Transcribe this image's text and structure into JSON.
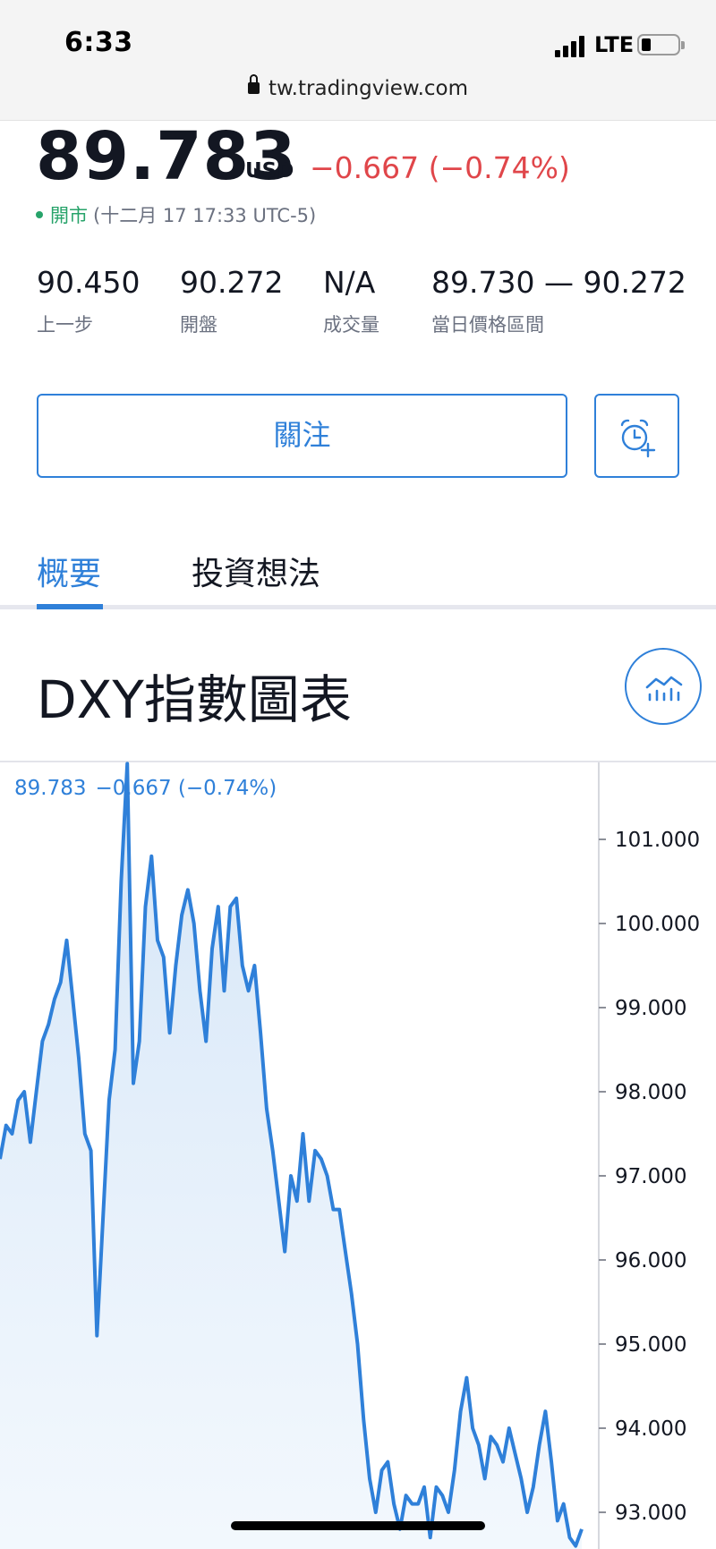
{
  "status_bar": {
    "time": "6:33",
    "network": "LTE",
    "url": "tw.tradingview.com"
  },
  "quote": {
    "price": "89.783",
    "currency": "USD",
    "change": "−0.667 (−0.74%)",
    "change_color": "#e0464a",
    "market_status": "開市",
    "market_status_color": "#27a36a",
    "timestamp": "(十二月 17 17:33 UTC-5)"
  },
  "stats": [
    {
      "value": "90.450",
      "label": "上一步"
    },
    {
      "value": "90.272",
      "label": "開盤"
    },
    {
      "value": "N/A",
      "label": "成交量"
    },
    {
      "value": "89.730 — 90.272",
      "label": "當日價格區間"
    }
  ],
  "actions": {
    "follow_label": "關注",
    "alert_icon": "alarm-clock-plus-icon"
  },
  "tabs": [
    {
      "label": "概要",
      "active": true
    },
    {
      "label": "投資想法",
      "active": false
    }
  ],
  "chart_section": {
    "title": "DXY指數圖表",
    "chart_button_icon": "chart-icon",
    "accent": "#2f80d9"
  },
  "chart_data": {
    "type": "area",
    "legend": {
      "value": "89.783",
      "change": "−0.667 (−0.74%)"
    },
    "y_ticks": [
      "101.000",
      "100.000",
      "99.000",
      "98.000",
      "97.000",
      "96.000",
      "95.000",
      "94.000",
      "93.000"
    ],
    "y_range": [
      92.0,
      102.2
    ],
    "series": [
      {
        "color": "#2f80d9",
        "values": [
          97.2,
          97.6,
          97.5,
          97.9,
          98.0,
          97.4,
          98.0,
          98.6,
          98.8,
          99.1,
          99.3,
          99.8,
          99.1,
          98.4,
          97.5,
          97.3,
          95.1,
          96.5,
          97.9,
          98.5,
          100.5,
          101.9,
          98.1,
          98.6,
          100.2,
          100.8,
          99.8,
          99.6,
          98.7,
          99.5,
          100.1,
          100.4,
          100.0,
          99.2,
          98.6,
          99.7,
          100.2,
          99.2,
          100.2,
          100.3,
          99.5,
          99.2,
          99.5,
          98.7,
          97.8,
          97.3,
          96.7,
          96.1,
          97.0,
          96.7,
          97.5,
          96.7,
          97.3,
          97.2,
          97.0,
          96.6,
          96.6,
          96.1,
          95.6,
          95.0,
          94.1,
          93.4,
          93.0,
          93.5,
          93.6,
          93.1,
          92.8,
          93.2,
          93.1,
          93.1,
          93.3,
          92.7,
          93.3,
          93.2,
          93.0,
          93.5,
          94.2,
          94.6,
          94.0,
          93.8,
          93.4,
          93.9,
          93.8,
          93.6,
          94.0,
          93.7,
          93.4,
          93.0,
          93.3,
          93.8,
          94.2,
          93.6,
          92.9,
          93.1,
          92.7,
          92.6,
          92.8
        ]
      }
    ]
  }
}
